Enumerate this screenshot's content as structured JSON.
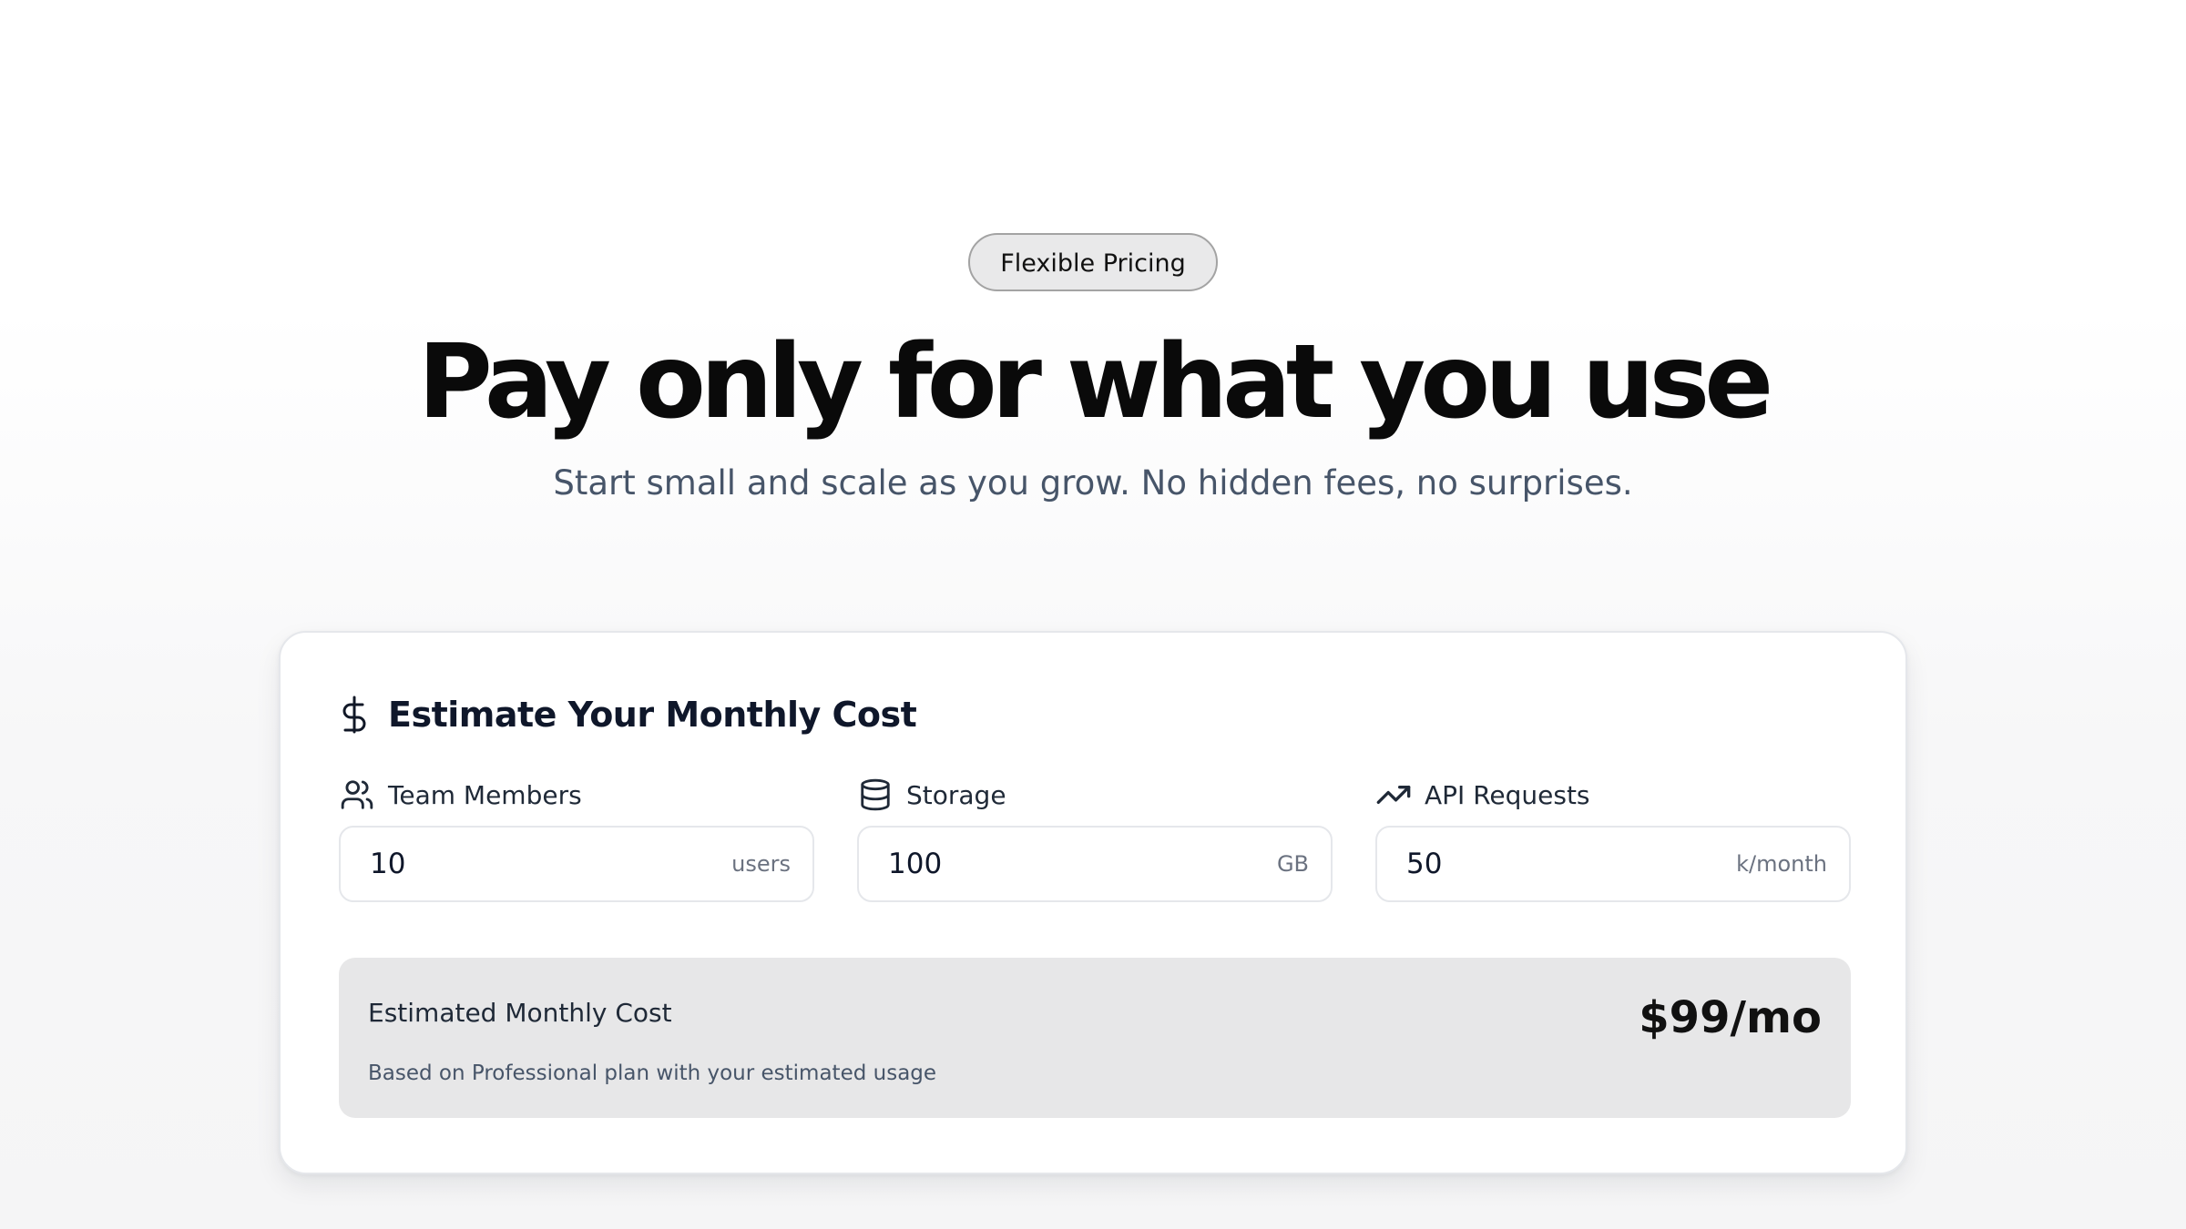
{
  "hero": {
    "badge": "Flexible Pricing",
    "headline": "Pay only for what you use",
    "subheadline": "Start small and scale as you grow. No hidden fees, no surprises."
  },
  "estimator": {
    "title": "Estimate Your Monthly Cost",
    "title_icon": "dollar-icon",
    "fields": [
      {
        "label": "Team Members",
        "icon": "users-icon",
        "value": "10",
        "unit": "users"
      },
      {
        "label": "Storage",
        "icon": "database-icon",
        "value": "100",
        "unit": "GB"
      },
      {
        "label": "API Requests",
        "icon": "trending-up-icon",
        "value": "50",
        "unit": "k/month"
      }
    ],
    "summary": {
      "title": "Estimated Monthly Cost",
      "note": "Based on Professional plan with your estimated usage",
      "price": "$99/mo"
    }
  },
  "colors": {
    "heading": "#0a0a0a",
    "subtext": "#475569",
    "badge_bg": "#e9e9ea",
    "summary_bg": "#e7e7e8",
    "border": "#e5e7eb"
  }
}
